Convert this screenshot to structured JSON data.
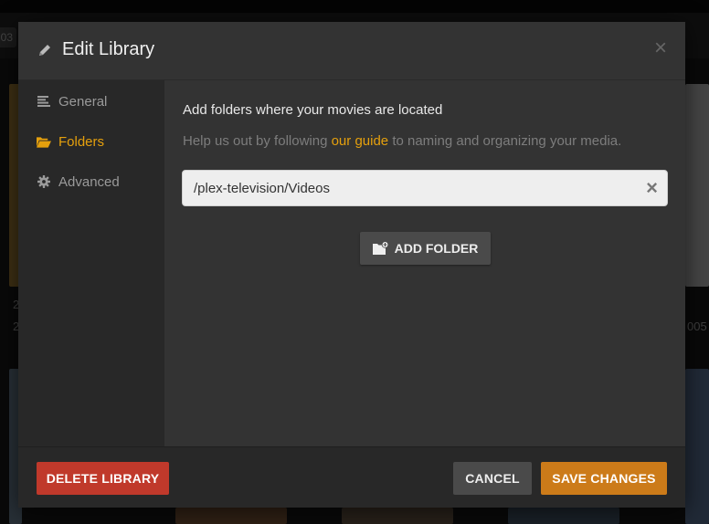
{
  "background": {
    "chip_text": "03",
    "left_caption_1": "2",
    "left_caption_2": "2",
    "right_caption": "005"
  },
  "modal": {
    "title": "Edit Library",
    "close_glyph": "×",
    "icon": "pencil-icon"
  },
  "sidebar": {
    "items": [
      {
        "label": "General",
        "icon": "align-left-icon",
        "active": false
      },
      {
        "label": "Folders",
        "icon": "folder-open-icon",
        "active": true
      },
      {
        "label": "Advanced",
        "icon": "gear-icon",
        "active": false
      }
    ]
  },
  "content": {
    "heading": "Add folders where your movies are located",
    "help_prefix": "Help us out by following ",
    "help_link": "our guide",
    "help_suffix": " to naming and organizing your media.",
    "folder_path": "/plex-television/Videos",
    "clear_glyph": "×",
    "add_folder_label": "ADD FOLDER"
  },
  "footer": {
    "delete_label": "DELETE LIBRARY",
    "cancel_label": "CANCEL",
    "save_label": "SAVE CHANGES"
  },
  "colors": {
    "accent": "#e5a00d",
    "danger": "#c0392b",
    "save": "#cc7b19"
  }
}
